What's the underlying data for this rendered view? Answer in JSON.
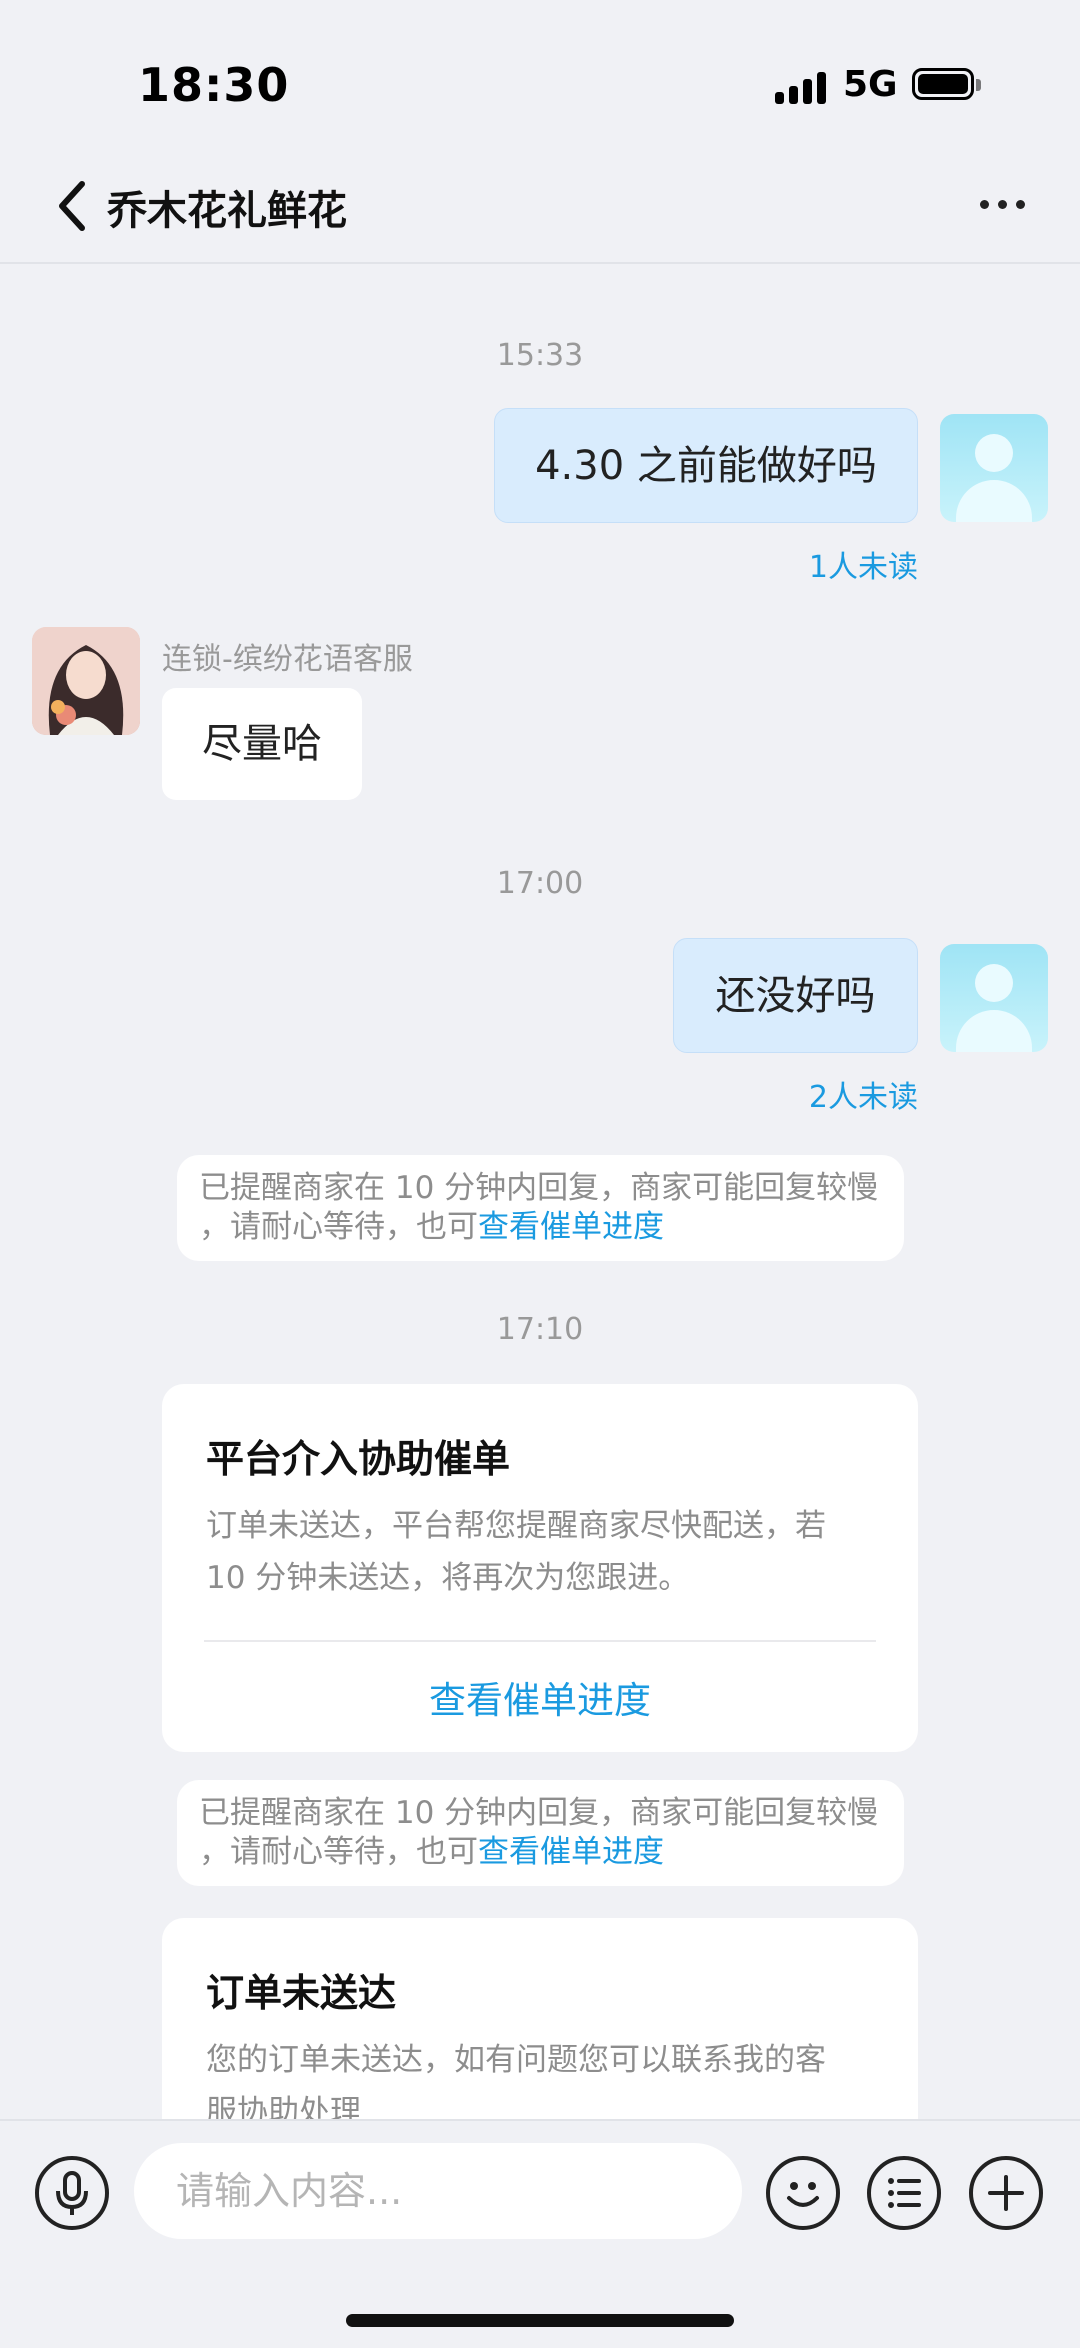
{
  "status_bar": {
    "time": "18:30",
    "network": "5G"
  },
  "header": {
    "title": "乔木花礼鲜花"
  },
  "chat": {
    "timestamps": [
      "15:33",
      "17:00",
      "17:10"
    ],
    "msg1": {
      "text": "4.30 之前能做好吗",
      "unread": "1人未读"
    },
    "shop_reply": {
      "sender": "连锁-缤纷花语客服",
      "text": "尽量哈"
    },
    "msg2": {
      "text": "还没好吗",
      "unread": "2人未读"
    },
    "notice": {
      "line1": "已提醒商家在 10 分钟内回复，商家可能回复较慢",
      "line2_prefix": "，请耐心等待，也可",
      "link": "查看催单进度"
    },
    "card_urge": {
      "title": "平台介入协助催单",
      "body_line1": "订单未送达，平台帮您提醒商家尽快配送，若",
      "body_line2": "10 分钟未送达，将再次为您跟进。",
      "action": "查看催单进度"
    },
    "card_undelivered": {
      "title": "订单未送达",
      "body_line1": "您的订单未送达，如有问题您可以联系我的客",
      "body_line2": "服协助处理"
    }
  },
  "input_bar": {
    "placeholder": "请输入内容..."
  }
}
